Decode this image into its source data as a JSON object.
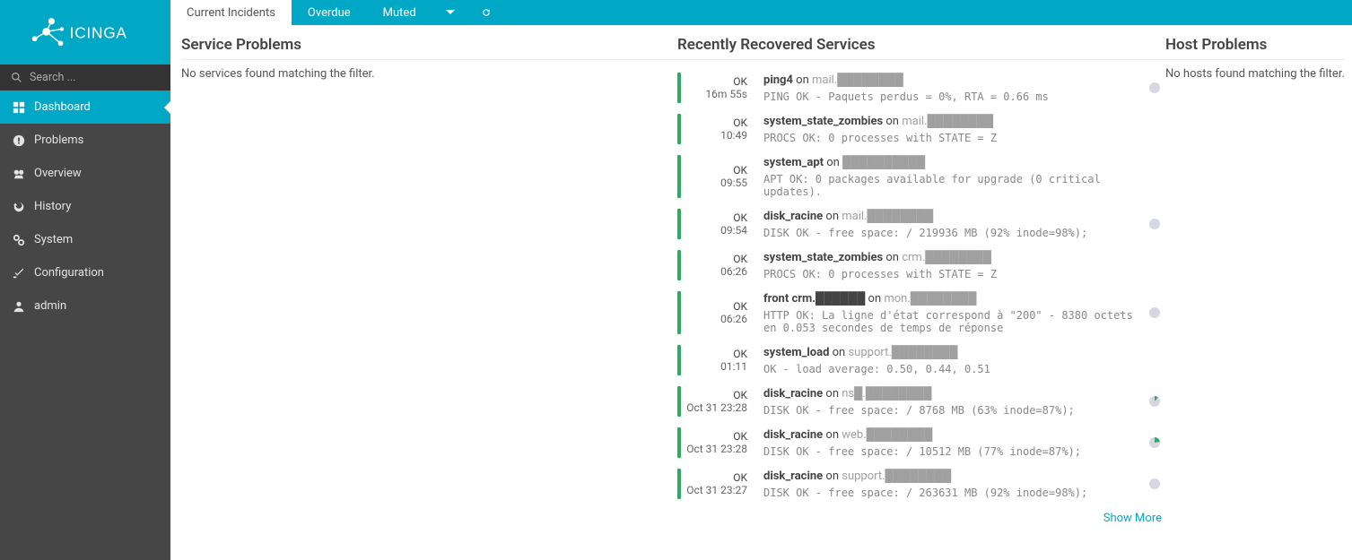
{
  "brand": "ICINGA",
  "search": {
    "placeholder": "Search ..."
  },
  "nav": {
    "dashboard": "Dashboard",
    "problems": "Problems",
    "overview": "Overview",
    "history": "History",
    "system": "System",
    "configuration": "Configuration",
    "admin": "admin"
  },
  "tabs": {
    "current": "Current Incidents",
    "overdue": "Overdue",
    "muted": "Muted"
  },
  "columns": {
    "service_problems": {
      "title": "Service Problems",
      "empty": "No services found matching the filter."
    },
    "recently_recovered": {
      "title": "Recently Recovered Services",
      "show_more": "Show More"
    },
    "host_problems": {
      "title": "Host Problems",
      "empty": "No hosts found matching the filter."
    }
  },
  "recovered": [
    {
      "state": "OK",
      "time": "16m 55s",
      "service": "ping4",
      "on": " on ",
      "host": "mail.████████",
      "output": "PING OK -  Paquets perdus = 0%, RTA = 0.66 ms",
      "pie": "plain"
    },
    {
      "state": "OK",
      "time": "10:49",
      "service": "system_state_zombies",
      "on": " on ",
      "host": "mail.████████",
      "output": "PROCS OK: 0 processes with STATE = Z",
      "pie": ""
    },
    {
      "state": "OK",
      "time": "09:55",
      "service": "system_apt",
      "on": " on ",
      "host": "██████████",
      "output": "APT OK: 0 packages available for upgrade (0 critical updates).",
      "pie": ""
    },
    {
      "state": "OK",
      "time": "09:54",
      "service": "disk_racine",
      "on": " on ",
      "host": "mail.████████",
      "output": "DISK OK - free space: / 219936 MB (92% inode=98%);",
      "pie": "plain"
    },
    {
      "state": "OK",
      "time": "06:26",
      "service": "system_state_zombies",
      "on": " on ",
      "host": "crm.████████",
      "output": "PROCS OK: 0 processes with STATE = Z",
      "pie": ""
    },
    {
      "state": "OK",
      "time": "06:26",
      "service": "front crm.██████",
      "on": " on ",
      "host": "mon.████████",
      "output": "HTTP OK: La ligne d'état correspond à \"200\" - 8380 octets en 0.053 secondes de temps de réponse",
      "pie": "plain"
    },
    {
      "state": "OK",
      "time": "01:11",
      "service": "system_load",
      "on": " on ",
      "host": "support.████████",
      "output": "OK - load average: 0.50, 0.44, 0.51",
      "pie": ""
    },
    {
      "state": "OK",
      "time": "Oct 31 23:28",
      "service": "disk_racine",
      "on": " on ",
      "host": "ns█.████████",
      "output": "DISK OK - free space: / 8768 MB (63% inode=87%);",
      "pie": "partial"
    },
    {
      "state": "OK",
      "time": "Oct 31 23:28",
      "service": "disk_racine",
      "on": " on ",
      "host": "web.████████",
      "output": "DISK OK - free space: / 10512 MB (77% inode=87%);",
      "pie": "quarter"
    },
    {
      "state": "OK",
      "time": "Oct 31 23:27",
      "service": "disk_racine",
      "on": " on ",
      "host": "support.████████",
      "output": "DISK OK - free space: / 263631 MB (92% inode=98%);",
      "pie": "plain"
    }
  ]
}
